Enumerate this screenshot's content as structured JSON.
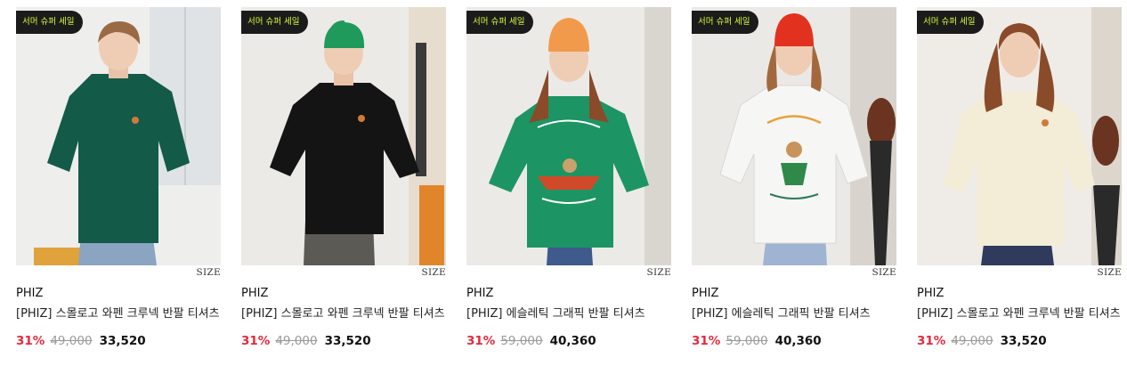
{
  "colors": {
    "badge_bg": "#1b1b1b",
    "badge_text": "#d8ff3e",
    "discount": "#e8283a",
    "original_price": "#9a9a9a"
  },
  "products": [
    {
      "badge": "서머 슈퍼 세일",
      "size_label": "SIZE",
      "brand": "PHIZ",
      "title": "[PHIZ] 스몰로고 와펜 크루넥 반팔 티셔츠",
      "discount": "31%",
      "original_price": "49,000",
      "price": "33,520",
      "shirt_color": "#145a48",
      "hat_color": null
    },
    {
      "badge": "서머 슈퍼 세일",
      "size_label": "SIZE",
      "brand": "PHIZ",
      "title": "[PHIZ] 스몰로고 와펜 크루넥 반팔 티셔츠",
      "discount": "31%",
      "original_price": "49,000",
      "price": "33,520",
      "shirt_color": "#141414",
      "hat_color": "#1f9a5a"
    },
    {
      "badge": "서머 슈퍼 세일",
      "size_label": "SIZE",
      "brand": "PHIZ",
      "title": "[PHIZ] 에슬레틱 그래픽 반팔 티셔츠",
      "discount": "31%",
      "original_price": "59,000",
      "price": "40,360",
      "shirt_color": "#1d9463",
      "hat_color": "#f29a4b"
    },
    {
      "badge": "서머 슈퍼 세일",
      "size_label": "SIZE",
      "brand": "PHIZ",
      "title": "[PHIZ] 에슬레틱 그래픽 반팔 티셔츠",
      "discount": "31%",
      "original_price": "59,000",
      "price": "40,360",
      "shirt_color": "#f6f6f4",
      "hat_color": "#e2321f"
    },
    {
      "badge": "서머 슈퍼 세일",
      "size_label": "SIZE",
      "brand": "PHIZ",
      "title": "[PHIZ] 스몰로고 와펜 크루넥 반팔 티셔츠",
      "discount": "31%",
      "original_price": "49,000",
      "price": "33,520",
      "shirt_color": "#f3ecd6",
      "hat_color": null
    }
  ]
}
